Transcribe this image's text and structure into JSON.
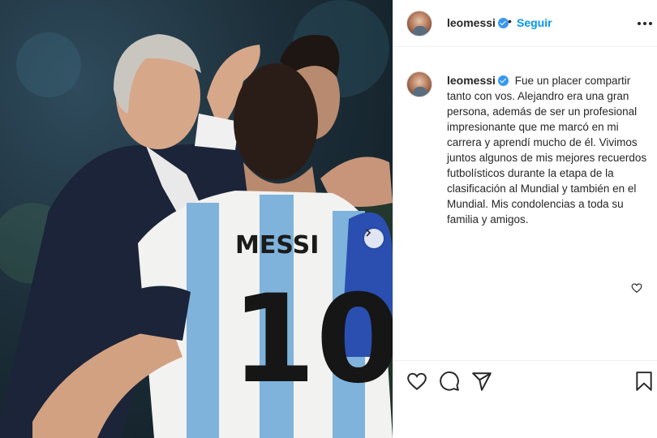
{
  "photo": {
    "jersey_name": "MESSI",
    "jersey_number": "10",
    "colors": {
      "sky_blue": "#7fb3dc",
      "white": "#f2f2f0",
      "suit": "#1b2438",
      "background": "#1d2f3a"
    }
  },
  "header": {
    "username": "leomessi",
    "separator": "•",
    "follow_label": "Seguir"
  },
  "comment": {
    "username": "leomessi",
    "text": "Fue un placer compartir tanto con vos. Alejandro era una gran persona, además de ser un profesional impresionante que me marcó en mi carrera y aprendí mucho de él. Vivimos juntos algunos de mis mejores recuerdos futbolísticos durante la etapa de la clasificación al Mundial y también en el Mundial. Mis condolencias a toda su familia y amigos."
  },
  "icons": {
    "like": "heart-icon",
    "comment": "comment-icon",
    "share": "share-icon",
    "save": "bookmark-icon",
    "more": "more-icon",
    "verified": "verified-icon"
  },
  "colors": {
    "accent": "#0095f6",
    "verified": "#3897f0",
    "text": "#262626",
    "border": "#efefef"
  }
}
